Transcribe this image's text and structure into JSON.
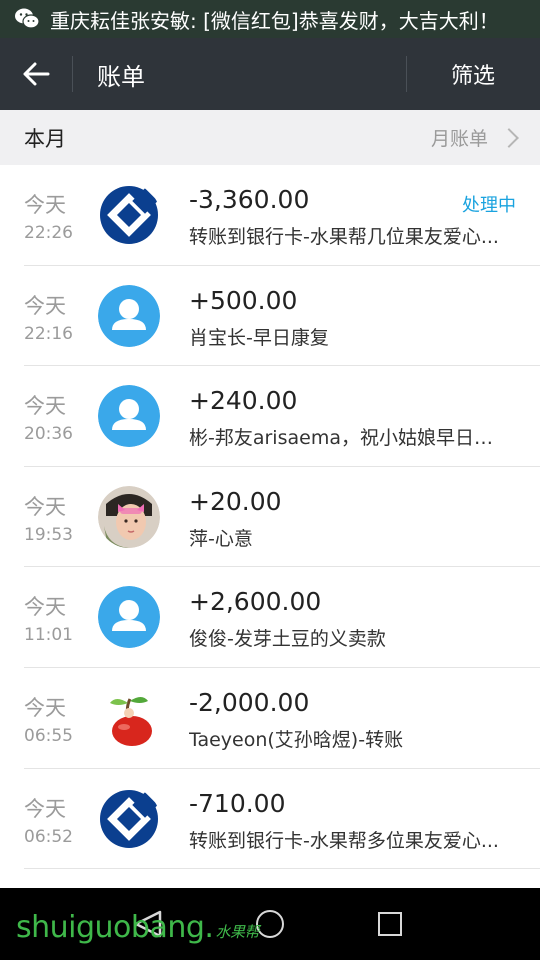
{
  "notification": {
    "text": "重庆耘佳张安敏: [微信红包]恭喜发财，大吉大利！",
    "icon": "wechat-icon"
  },
  "header": {
    "title": "账单",
    "filter_label": "筛选",
    "background": "#2f343a"
  },
  "section": {
    "title": "本月",
    "monthly_label": "月账单"
  },
  "transactions": [
    {
      "day": "今天",
      "time": "22:26",
      "amount": "-3,360.00",
      "desc": "转账到银行卡-水果帮几位果友爱心...",
      "status": "处理中",
      "avatar": "bank-icon"
    },
    {
      "day": "今天",
      "time": "22:16",
      "amount": "+500.00",
      "desc": "肖宝长-早日康复",
      "status": "",
      "avatar": "default-user-icon"
    },
    {
      "day": "今天",
      "time": "20:36",
      "amount": "+240.00",
      "desc": "彬-邦友arisaema，祝小姑娘早日康...",
      "status": "",
      "avatar": "default-user-icon"
    },
    {
      "day": "今天",
      "time": "19:53",
      "amount": "+20.00",
      "desc": "萍-心意",
      "status": "",
      "avatar": "user-photo"
    },
    {
      "day": "今天",
      "time": "11:01",
      "amount": "+2,600.00",
      "desc": "俊俊-发芽土豆的义卖款",
      "status": "",
      "avatar": "default-user-icon"
    },
    {
      "day": "今天",
      "time": "06:55",
      "amount": "-2,000.00",
      "desc": "Taeyeon(艾孙晗煜)-转账",
      "status": "",
      "avatar": "fruit-avatar"
    },
    {
      "day": "今天",
      "time": "06:52",
      "amount": "-710.00",
      "desc": "转账到银行卡-水果帮多位果友爱心...",
      "status": "",
      "avatar": "bank-icon"
    }
  ],
  "watermark": {
    "text": "shuiguobang.",
    "cn": "水果帮"
  },
  "colors": {
    "accent_status": "#1aa3df",
    "bank_blue": "#0b3f8f",
    "user_blue": "#3aa8ea"
  }
}
